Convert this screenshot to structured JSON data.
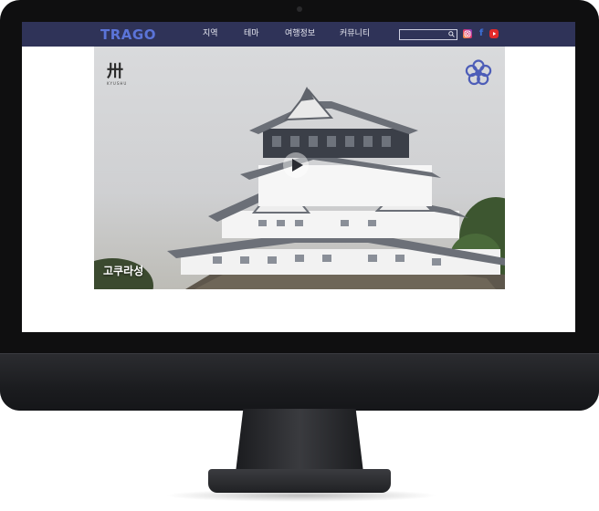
{
  "header": {
    "logo": "TRAGO",
    "nav": [
      "지역",
      "테마",
      "여행정보",
      "커뮤니티"
    ],
    "search": {
      "placeholder": ""
    },
    "social": [
      "instagram-icon",
      "facebook-icon",
      "youtube-icon"
    ]
  },
  "hero": {
    "brand_mark": "卅",
    "brand_sub": "KYUSHU",
    "caption": "고쿠라성"
  },
  "colors": {
    "nav_bg": "#2f3358",
    "accent": "#5b74d8",
    "flower_logo": "#4d5db8"
  }
}
